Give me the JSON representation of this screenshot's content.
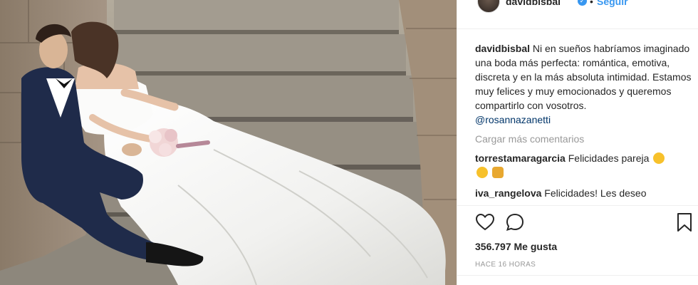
{
  "post": {
    "owner_username": "davidbisbal",
    "follow_label": "Seguir",
    "separator": "•",
    "caption_user": "davidbisbal",
    "caption_text": "Ni en sueños habríamos imaginado una boda más perfecta: romántica, emotiva, discreta y en la más absoluta intimidad. Estamos muy felices y muy emocionados y queremos compartirlo con vosotros.",
    "caption_mention": "@rosannazanetti",
    "load_more_label": "Cargar más comentarios",
    "comments": [
      {
        "user": "torrestamaragarcia",
        "text": "Felicidades pareja"
      },
      {
        "user": "iva_rangelova",
        "text": "Felicidades! Les deseo"
      }
    ],
    "likes": "356.797 Me gusta",
    "time_ago": "Hace 16 horas"
  },
  "icons": {
    "verified": "verified-badge-icon",
    "like": "heart-outline-icon",
    "comment": "comment-bubble-icon",
    "save": "bookmark-icon"
  },
  "colors": {
    "link_blue": "#3897f0",
    "mention_blue": "#003569",
    "muted_gray": "#999999",
    "text": "#262626"
  }
}
